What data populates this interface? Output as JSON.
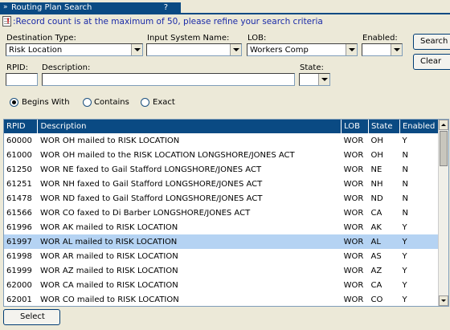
{
  "window": {
    "title": "Routing Plan Search",
    "help": "?"
  },
  "message": ":Record count is at the maximum of 50, please refine your search criteria",
  "filters": {
    "destination_type_label": "Destination Type:",
    "destination_type_value": "Risk Location",
    "input_system_label": "Input System Name:",
    "input_system_value": "",
    "lob_label": "LOB:",
    "lob_value": "Workers Comp",
    "enabled_label": "Enabled:",
    "enabled_value": "",
    "rpid_label": "RPID:",
    "rpid_value": "",
    "description_label": "Description:",
    "description_value": "",
    "state_label": "State:",
    "state_value": ""
  },
  "buttons": {
    "search": "Search",
    "clear": "Clear",
    "select": "Select"
  },
  "match_options": [
    {
      "label": "Begins With",
      "selected": true
    },
    {
      "label": "Contains",
      "selected": false
    },
    {
      "label": "Exact",
      "selected": false
    }
  ],
  "grid": {
    "columns": [
      "RPID",
      "Description",
      "LOB",
      "State",
      "Enabled"
    ],
    "rows": [
      [
        "60000",
        "WOR OH mailed to RISK LOCATION",
        "WOR",
        "OH",
        "Y"
      ],
      [
        "61000",
        "WOR OH mailed to the RISK LOCATION LONGSHORE/JONES ACT",
        "WOR",
        "OH",
        "N"
      ],
      [
        "61250",
        "WOR NE faxed to Gail Stafford LONGSHORE/JONES ACT",
        "WOR",
        "NE",
        "N"
      ],
      [
        "61251",
        "WOR NH faxed to Gail Stafford LONGSHORE/JONES ACT",
        "WOR",
        "NH",
        "N"
      ],
      [
        "61478",
        "WOR ND faxed to Gail Stafford LONGSHORE/JONES ACT",
        "WOR",
        "ND",
        "N"
      ],
      [
        "61566",
        "WOR CO faxed to Di Barber LONGSHORE/JONES ACT",
        "WOR",
        "CA",
        "N"
      ],
      [
        "61996",
        "WOR AK mailed to RISK LOCATION",
        "WOR",
        "AK",
        "Y"
      ],
      [
        "61997",
        "WOR AL mailed to RISK LOCATION",
        "WOR",
        "AL",
        "Y"
      ],
      [
        "61998",
        "WOR AR mailed to RISK LOCATION",
        "WOR",
        "AS",
        "Y"
      ],
      [
        "61999",
        "WOR AZ mailed to RISK LOCATION",
        "WOR",
        "AZ",
        "Y"
      ],
      [
        "62000",
        "WOR CA mailed to RISK LOCATION",
        "WOR",
        "CA",
        "Y"
      ],
      [
        "62001",
        "WOR CO mailed to RISK LOCATION",
        "WOR",
        "CO",
        "Y"
      ]
    ],
    "selected_rpid": "61997"
  }
}
